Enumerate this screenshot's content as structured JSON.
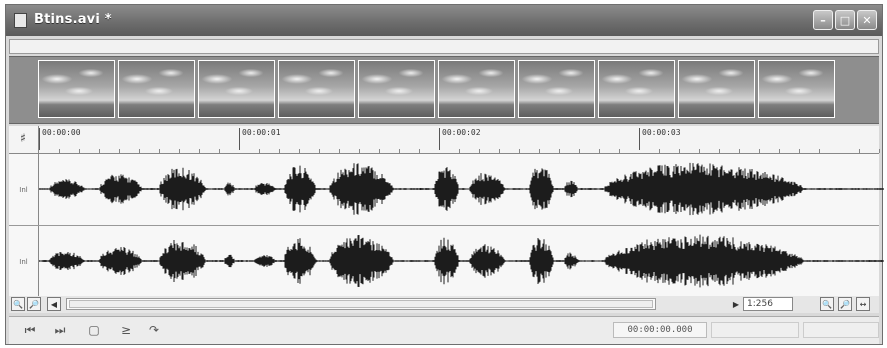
{
  "window": {
    "title": "Btins.avi *",
    "controls": [
      "minimize-icon",
      "maximize-icon",
      "close-icon"
    ]
  },
  "filmstrip": {
    "frame_count": 10,
    "frame_subject": "sky with clouds"
  },
  "ruler": {
    "timecodes": [
      "00:00:00",
      "00:00:01",
      "00:00:02",
      "00:00:03"
    ]
  },
  "tracks": [
    {
      "label": "Inl"
    },
    {
      "label": "Inl"
    }
  ],
  "scroll": {
    "zoom_value": "1:256"
  },
  "transport": {
    "buttons": [
      "go-to-start-icon",
      "go-to-end-icon",
      "stop-icon",
      "play-from-cursor-icon",
      "loop-icon"
    ],
    "timecode": "00:00:00.000"
  }
}
